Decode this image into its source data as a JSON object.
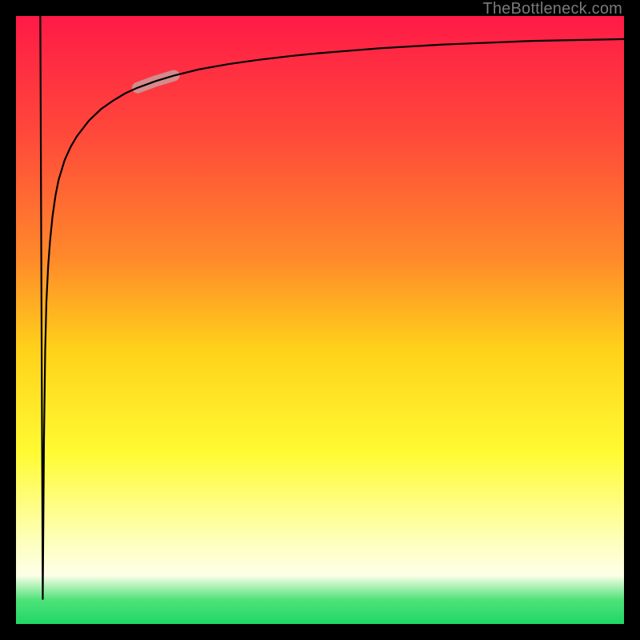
{
  "watermark": "TheBottleneck.com",
  "chart_data": {
    "type": "line",
    "title": "",
    "xlabel": "",
    "ylabel": "",
    "xlim": [
      0,
      100
    ],
    "ylim": [
      0,
      100
    ],
    "series": [
      {
        "name": "curve",
        "x": [
          4.0,
          4.2,
          4.4,
          4.6,
          4.8,
          5.0,
          5.3,
          5.6,
          6.0,
          6.5,
          7.0,
          8.0,
          9.0,
          10.0,
          12.0,
          14.0,
          16.0,
          18.0,
          20.0,
          23.0,
          26.0,
          30.0,
          35.0,
          40.0,
          45.0,
          50.0,
          55.0,
          60.0,
          65.0,
          70.0,
          75.0,
          80.0,
          85.0,
          90.0,
          95.0,
          100.0
        ],
        "y": [
          100.0,
          50.0,
          4.0,
          30.0,
          45.0,
          53.0,
          59.0,
          63.0,
          67.0,
          70.5,
          73.0,
          76.3,
          78.5,
          80.2,
          82.8,
          84.7,
          86.1,
          87.3,
          88.2,
          89.3,
          90.2,
          91.2,
          92.1,
          92.8,
          93.4,
          93.9,
          94.3,
          94.7,
          95.0,
          95.3,
          95.5,
          95.7,
          95.9,
          96.0,
          96.1,
          96.2
        ]
      }
    ],
    "highlight_band": {
      "x_start": 20.0,
      "x_end": 26.0,
      "y_start": 88.2,
      "y_end": 90.2,
      "color": "#cf9595"
    },
    "background_gradient": [
      {
        "stop": 0.0,
        "color": "#ff1a47"
      },
      {
        "stop": 0.2,
        "color": "#ff4a3a"
      },
      {
        "stop": 0.4,
        "color": "#ff8a2a"
      },
      {
        "stop": 0.55,
        "color": "#ffd21a"
      },
      {
        "stop": 0.72,
        "color": "#fffb33"
      },
      {
        "stop": 0.86,
        "color": "#fdffb8"
      },
      {
        "stop": 0.92,
        "color": "#fdffe8"
      },
      {
        "stop": 0.96,
        "color": "#4fe27a"
      },
      {
        "stop": 1.0,
        "color": "#1fd765"
      }
    ]
  }
}
